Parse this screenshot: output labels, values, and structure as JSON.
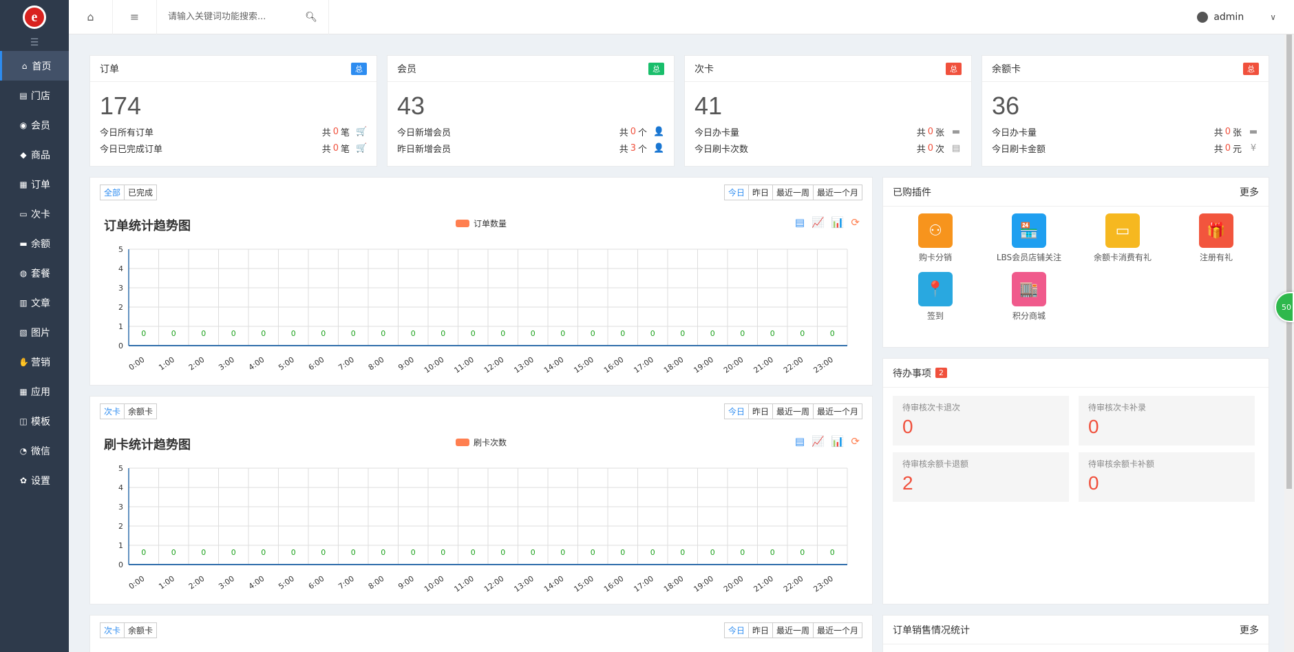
{
  "sidebar": {
    "logo": "e",
    "items": [
      {
        "icon": "home-icon",
        "glyph": "⌂",
        "label": "首页"
      },
      {
        "icon": "store-icon",
        "glyph": "▤",
        "label": "门店"
      },
      {
        "icon": "member-icon",
        "glyph": "◉",
        "label": "会员"
      },
      {
        "icon": "tag-icon",
        "glyph": "◆",
        "label": "商品"
      },
      {
        "icon": "order-icon",
        "glyph": "▦",
        "label": "订单"
      },
      {
        "icon": "card-icon",
        "glyph": "▭",
        "label": "次卡"
      },
      {
        "icon": "balance-icon",
        "glyph": "▬",
        "label": "余额"
      },
      {
        "icon": "package-icon",
        "glyph": "◍",
        "label": "套餐"
      },
      {
        "icon": "article-icon",
        "glyph": "▥",
        "label": "文章"
      },
      {
        "icon": "image-icon",
        "glyph": "▧",
        "label": "图片"
      },
      {
        "icon": "thumbs-up-icon",
        "glyph": "✋",
        "label": "营销"
      },
      {
        "icon": "grid-icon",
        "glyph": "▦",
        "label": "应用"
      },
      {
        "icon": "layout-icon",
        "glyph": "◫",
        "label": "模板"
      },
      {
        "icon": "wechat-icon",
        "glyph": "◔",
        "label": "微信"
      },
      {
        "icon": "settings-icon",
        "glyph": "✿",
        "label": "设置"
      }
    ]
  },
  "topbar": {
    "search_placeholder": "请输入关键词功能搜索...",
    "user": "admin"
  },
  "stats": [
    {
      "title": "订单",
      "badge": "总",
      "badge_color": "#2d8cf0",
      "value": "174",
      "rows": [
        {
          "label": "今日所有订单",
          "pre": "共",
          "num": "0",
          "unit": "笔",
          "icon": "cart-icon",
          "glyph": "🛒"
        },
        {
          "label": "今日已完成订单",
          "pre": "共",
          "num": "0",
          "unit": "笔",
          "icon": "cart-icon",
          "glyph": "🛒"
        }
      ]
    },
    {
      "title": "会员",
      "badge": "总",
      "badge_color": "#19be6b",
      "value": "43",
      "rows": [
        {
          "label": "今日新增会员",
          "pre": "共",
          "num": "0",
          "unit": "个",
          "icon": "user-icon",
          "glyph": "👤"
        },
        {
          "label": "昨日新增会员",
          "pre": "共",
          "num": "3",
          "unit": "个",
          "icon": "user-icon",
          "glyph": "👤"
        }
      ]
    },
    {
      "title": "次卡",
      "badge": "总",
      "badge_color": "#f0503c",
      "value": "41",
      "rows": [
        {
          "label": "今日办卡量",
          "pre": "共",
          "num": "0",
          "unit": "张",
          "icon": "card-icon",
          "glyph": "▬"
        },
        {
          "label": "今日刷卡次数",
          "pre": "共",
          "num": "0",
          "unit": "次",
          "icon": "clipboard-icon",
          "glyph": "▤"
        }
      ]
    },
    {
      "title": "余额卡",
      "badge": "总",
      "badge_color": "#f0503c",
      "value": "36",
      "rows": [
        {
          "label": "今日办卡量",
          "pre": "共",
          "num": "0",
          "unit": "张",
          "icon": "card-icon",
          "glyph": "▬"
        },
        {
          "label": "今日刷卡金额",
          "pre": "共",
          "num": "0",
          "unit": "元",
          "icon": "yen-icon",
          "glyph": "¥"
        }
      ]
    }
  ],
  "period_tabs": [
    "今日",
    "昨日",
    "最近一周",
    "最近一个月"
  ],
  "chart1": {
    "tabs": [
      "全部",
      "已完成"
    ],
    "tools": [
      {
        "icon": "data-view-icon",
        "glyph": "▤",
        "color": "#2d8cf0"
      },
      {
        "icon": "line-chart-icon",
        "glyph": "📈",
        "color": "#19be6b"
      },
      {
        "icon": "bar-chart-icon",
        "glyph": "📊",
        "color": "#8e44ad"
      },
      {
        "icon": "refresh-icon",
        "glyph": "⟳",
        "color": "#ff7f50"
      }
    ]
  },
  "chart2": {
    "tabs": [
      "次卡",
      "余额卡"
    ]
  },
  "chart3": {
    "tabs": [
      "次卡",
      "余额卡"
    ]
  },
  "chart_data": [
    {
      "type": "bar",
      "title": "订单统计趋势图",
      "categories": [
        "0:00",
        "1:00",
        "2:00",
        "3:00",
        "4:00",
        "5:00",
        "6:00",
        "7:00",
        "8:00",
        "9:00",
        "10:00",
        "11:00",
        "12:00",
        "13:00",
        "14:00",
        "15:00",
        "16:00",
        "17:00",
        "18:00",
        "19:00",
        "20:00",
        "21:00",
        "22:00",
        "23:00"
      ],
      "series": [
        {
          "name": "订单数量",
          "values": [
            0,
            0,
            0,
            0,
            0,
            0,
            0,
            0,
            0,
            0,
            0,
            0,
            0,
            0,
            0,
            0,
            0,
            0,
            0,
            0,
            0,
            0,
            0,
            0
          ],
          "color": "#ff7f50"
        }
      ],
      "ylim": [
        0,
        5
      ],
      "yticks": [
        "0",
        "1",
        "2",
        "3",
        "4",
        "5"
      ],
      "grid": true,
      "legend": "top-center"
    },
    {
      "type": "bar",
      "title": "刷卡统计趋势图",
      "categories": [
        "0:00",
        "1:00",
        "2:00",
        "3:00",
        "4:00",
        "5:00",
        "6:00",
        "7:00",
        "8:00",
        "9:00",
        "10:00",
        "11:00",
        "12:00",
        "13:00",
        "14:00",
        "15:00",
        "16:00",
        "17:00",
        "18:00",
        "19:00",
        "20:00",
        "21:00",
        "22:00",
        "23:00"
      ],
      "series": [
        {
          "name": "刷卡次数",
          "values": [
            0,
            0,
            0,
            0,
            0,
            0,
            0,
            0,
            0,
            0,
            0,
            0,
            0,
            0,
            0,
            0,
            0,
            0,
            0,
            0,
            0,
            0,
            0,
            0
          ],
          "color": "#ff7f50"
        }
      ],
      "ylim": [
        0,
        5
      ],
      "yticks": [
        "0",
        "1",
        "2",
        "3",
        "4",
        "5"
      ],
      "grid": true,
      "legend": "top-center"
    }
  ],
  "plugins": {
    "title": "已购插件",
    "more": "更多",
    "items": [
      {
        "label": "购卡分销",
        "icon": "distribution-icon",
        "glyph": "⚇",
        "color": "#f7941d"
      },
      {
        "label": "LBS会员店铺关注",
        "icon": "shop-icon",
        "glyph": "🏪",
        "color": "#1f9ff0"
      },
      {
        "label": "余额卡消费有礼",
        "icon": "card-gift-icon",
        "glyph": "▭",
        "color": "#f6b820"
      },
      {
        "label": "注册有礼",
        "icon": "gift-icon",
        "glyph": "🎁",
        "color": "#f2553d"
      },
      {
        "label": "签到",
        "icon": "location-pin-icon",
        "glyph": "📍",
        "color": "#29a8e0"
      },
      {
        "label": "积分商城",
        "icon": "mall-icon",
        "glyph": "🏬",
        "color": "#f05a8c"
      }
    ]
  },
  "todo": {
    "title": "待办事项",
    "count": "2",
    "items": [
      {
        "label": "待审核次卡退次",
        "value": "0"
      },
      {
        "label": "待审核次卡补录",
        "value": "0"
      },
      {
        "label": "待审核余额卡退额",
        "value": "2"
      },
      {
        "label": "待审核余额卡补额",
        "value": "0"
      }
    ]
  },
  "sales": {
    "title": "订单销售情况统计",
    "more": "更多"
  },
  "float_badge": "50"
}
